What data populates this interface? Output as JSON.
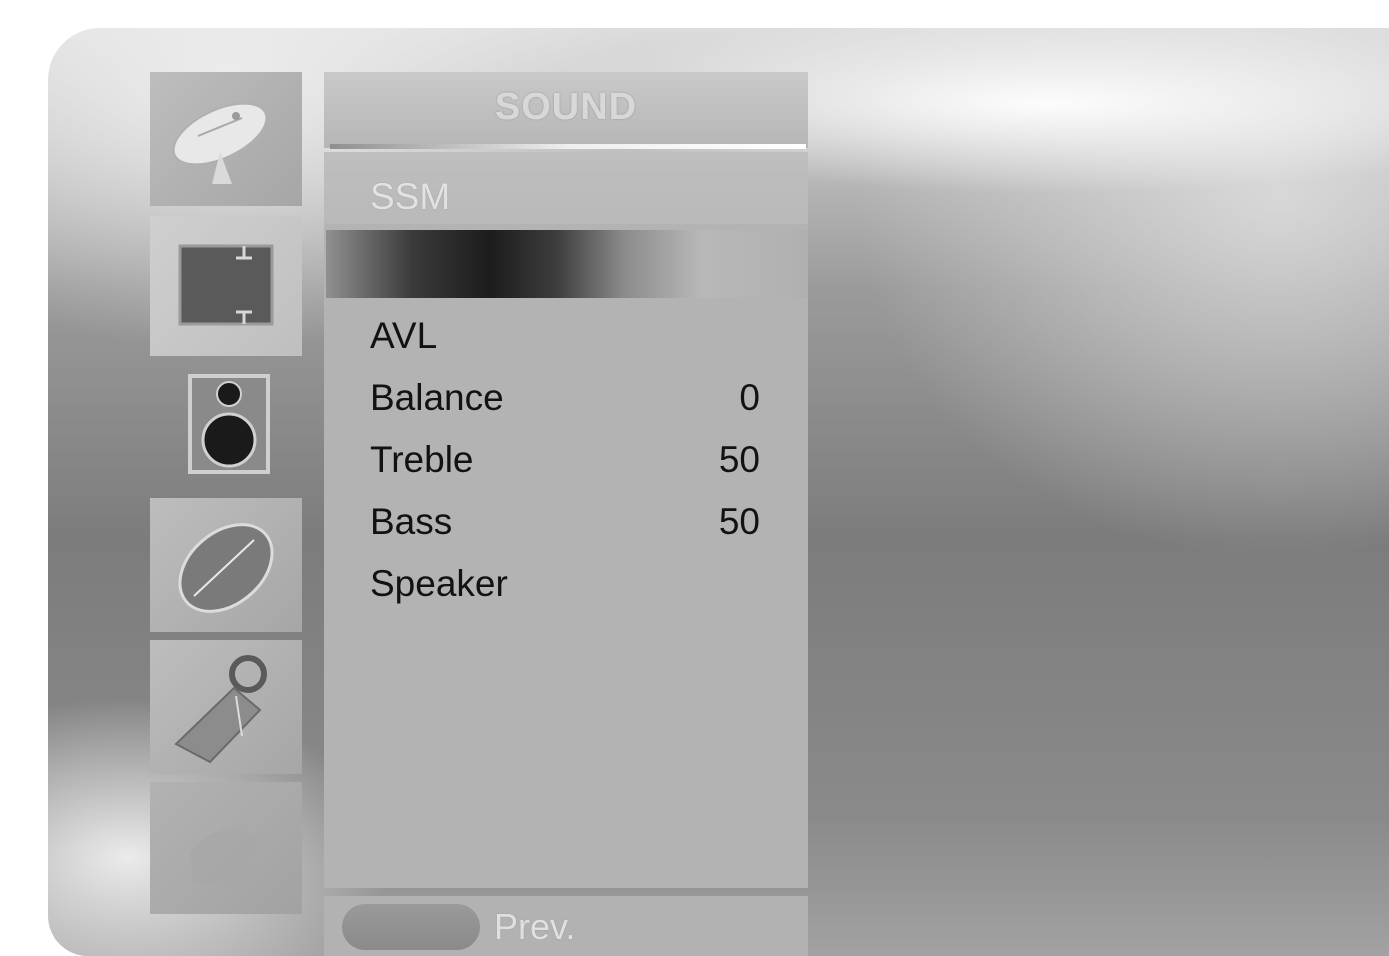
{
  "menu": {
    "title": "SOUND",
    "items": [
      {
        "label": "SSM",
        "value": ""
      },
      {
        "label": "",
        "value": ""
      },
      {
        "label": "AVL",
        "value": ""
      },
      {
        "label": "Balance",
        "value": "0"
      },
      {
        "label": "Treble",
        "value": "50"
      },
      {
        "label": "Bass",
        "value": "50"
      },
      {
        "label": "Speaker",
        "value": ""
      }
    ]
  },
  "footer": {
    "prev_label": "Prev."
  },
  "sidebar": {
    "icons": [
      "satellite-dish-icon",
      "picture-icon",
      "speaker-icon",
      "clock-icon",
      "key-lock-icon",
      "special-icon"
    ]
  },
  "colors": {
    "selected_bar": "#1c1c1c",
    "panel": "#b3b3b3"
  }
}
